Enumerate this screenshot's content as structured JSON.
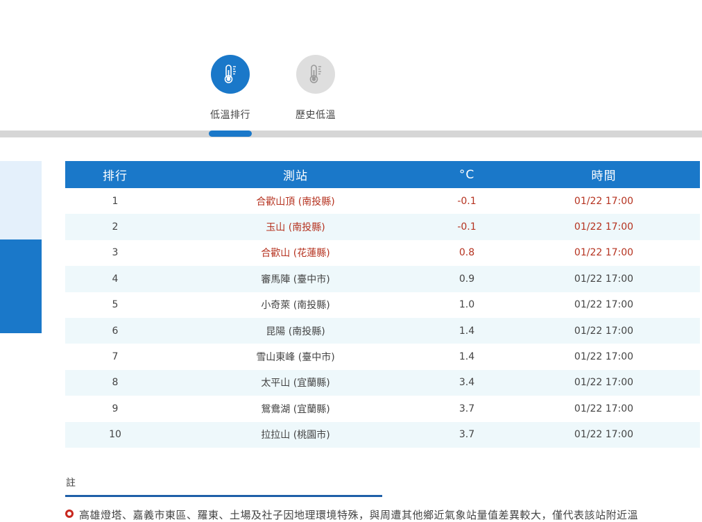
{
  "tabs": [
    {
      "label": "低溫排行",
      "icon": "thermometer-icon",
      "active": true
    },
    {
      "label": "歷史低溫",
      "icon": "thermometer-icon",
      "active": false
    }
  ],
  "table": {
    "headers": [
      "排行",
      "測站",
      "°C",
      "時間"
    ],
    "rows": [
      {
        "rank": "1",
        "station": "合歡山頂 (南投縣)",
        "temp": "-0.1",
        "time": "01/22 17:00"
      },
      {
        "rank": "2",
        "station": "玉山 (南投縣)",
        "temp": "-0.1",
        "time": "01/22 17:00"
      },
      {
        "rank": "3",
        "station": "合歡山 (花蓮縣)",
        "temp": "0.8",
        "time": "01/22 17:00"
      },
      {
        "rank": "4",
        "station": "審馬陣 (臺中市)",
        "temp": "0.9",
        "time": "01/22 17:00"
      },
      {
        "rank": "5",
        "station": "小奇萊 (南投縣)",
        "temp": "1.0",
        "time": "01/22 17:00"
      },
      {
        "rank": "6",
        "station": "昆陽 (南投縣)",
        "temp": "1.4",
        "time": "01/22 17:00"
      },
      {
        "rank": "7",
        "station": "雪山東峰 (臺中市)",
        "temp": "1.4",
        "time": "01/22 17:00"
      },
      {
        "rank": "8",
        "station": "太平山 (宜蘭縣)",
        "temp": "3.4",
        "time": "01/22 17:00"
      },
      {
        "rank": "9",
        "station": "鴛鴦湖 (宜蘭縣)",
        "temp": "3.7",
        "time": "01/22 17:00"
      },
      {
        "rank": "10",
        "station": "拉拉山 (桃園市)",
        "temp": "3.7",
        "time": "01/22 17:00"
      }
    ]
  },
  "notes": {
    "title": "註",
    "items": [
      "高雄燈塔、嘉義市東區、羅東、土場及社子因地理環境特殊，與周遭其他鄉近氣象站量值差異較大，僅代表該站附近溫"
    ]
  },
  "colors": {
    "accent": "#1a78c9",
    "highlight_text": "#b5321f",
    "row_alt": "#eef8fb"
  }
}
